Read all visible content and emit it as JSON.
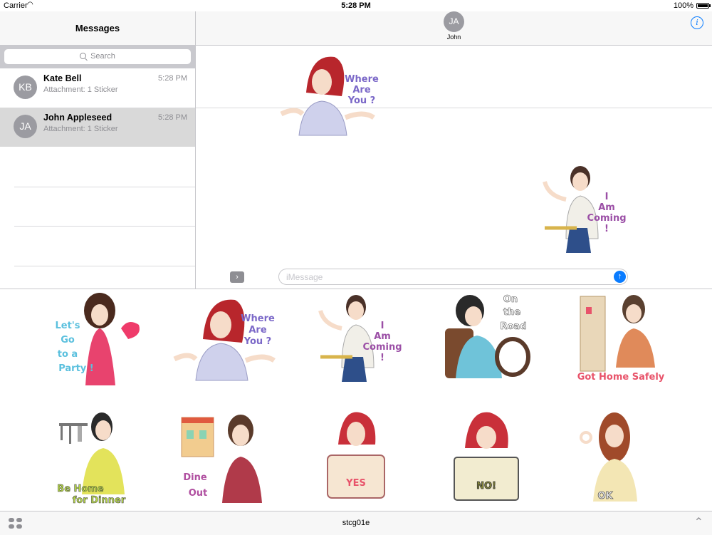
{
  "status_bar": {
    "carrier": "Carrier",
    "time": "5:28 PM",
    "battery": "100%"
  },
  "sidebar": {
    "title": "Messages",
    "search_placeholder": "Search",
    "conversations": [
      {
        "initials": "KB",
        "name": "Kate Bell",
        "preview": "Attachment: 1 Sticker",
        "time": "5:28 PM"
      },
      {
        "initials": "JA",
        "name": "John Appleseed",
        "preview": "Attachment: 1 Sticker",
        "time": "5:28 PM"
      }
    ]
  },
  "chat": {
    "contact_initials": "JA",
    "contact_name": "John",
    "messages": [
      {
        "sticker": "Where Are You ?",
        "lines": [
          "Where",
          "Are",
          "You ?"
        ]
      },
      {
        "sticker": "I Am Coming !",
        "lines": [
          "I",
          "Am",
          "Coming",
          "!"
        ]
      }
    ],
    "input_placeholder": "iMessage"
  },
  "drawer": {
    "stickers": [
      {
        "text": "Let's Go to a Party !",
        "lines": [
          "Let's",
          "Go",
          "to a",
          "Party !"
        ],
        "text_color": "#5bc0de"
      },
      {
        "text": "Where Are You ?",
        "lines": [
          "Where",
          "Are",
          "You ?"
        ],
        "text_color": "#7b68c8"
      },
      {
        "text": "I Am Coming !",
        "lines": [
          "I",
          "Am",
          "Coming",
          "!"
        ],
        "text_color": "#9b4fa6"
      },
      {
        "text": "On the Road",
        "lines": [
          "On",
          "the",
          "Road"
        ],
        "text_color": "#ffffff"
      },
      {
        "text": "Got Home Safely",
        "lines": [
          "Got Home Safely"
        ],
        "text_color": "#e8536a"
      },
      {
        "text": "Be Home for Dinner",
        "lines": [
          "Be Home",
          "for Dinner"
        ],
        "text_color": "#b6d64a"
      },
      {
        "text": "Dine Out",
        "lines": [
          "Dine",
          "Out"
        ],
        "text_color": "#b04fa0"
      },
      {
        "text": "YES",
        "lines": [
          "YES"
        ],
        "text_color": "#e8536a"
      },
      {
        "text": "NO!",
        "lines": [
          "NO!"
        ],
        "text_color": "#8a8a3a"
      },
      {
        "text": "OK",
        "lines": [
          "OK"
        ],
        "text_color": "#f7f7f7"
      }
    ]
  },
  "bottom_bar": {
    "pack_name": "stcg01e"
  }
}
